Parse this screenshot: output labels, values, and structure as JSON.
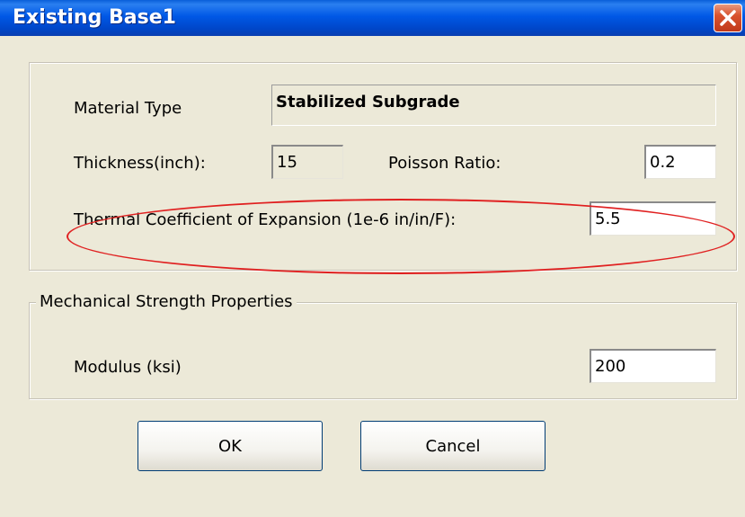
{
  "window": {
    "title": "Existing Base1"
  },
  "material": {
    "label": "Material Type",
    "value": "Stabilized Subgrade"
  },
  "thickness": {
    "label": "Thickness(inch):",
    "value": "15"
  },
  "poisson": {
    "label": "Poisson Ratio:",
    "value": "0.2"
  },
  "thermal": {
    "label": "Thermal Coefficient of Expansion (1e-6 in/in/F):",
    "value": "5.5"
  },
  "mechanical": {
    "legend": "Mechanical Strength Properties",
    "modulus_label": "Modulus (ksi)",
    "modulus_value": "200"
  },
  "buttons": {
    "ok": "OK",
    "cancel": "Cancel"
  },
  "icons": {
    "close": "close-icon"
  },
  "colors": {
    "title_bar": "#0058e6",
    "close_button": "#d9532f",
    "highlight_oval": "#e02020"
  }
}
